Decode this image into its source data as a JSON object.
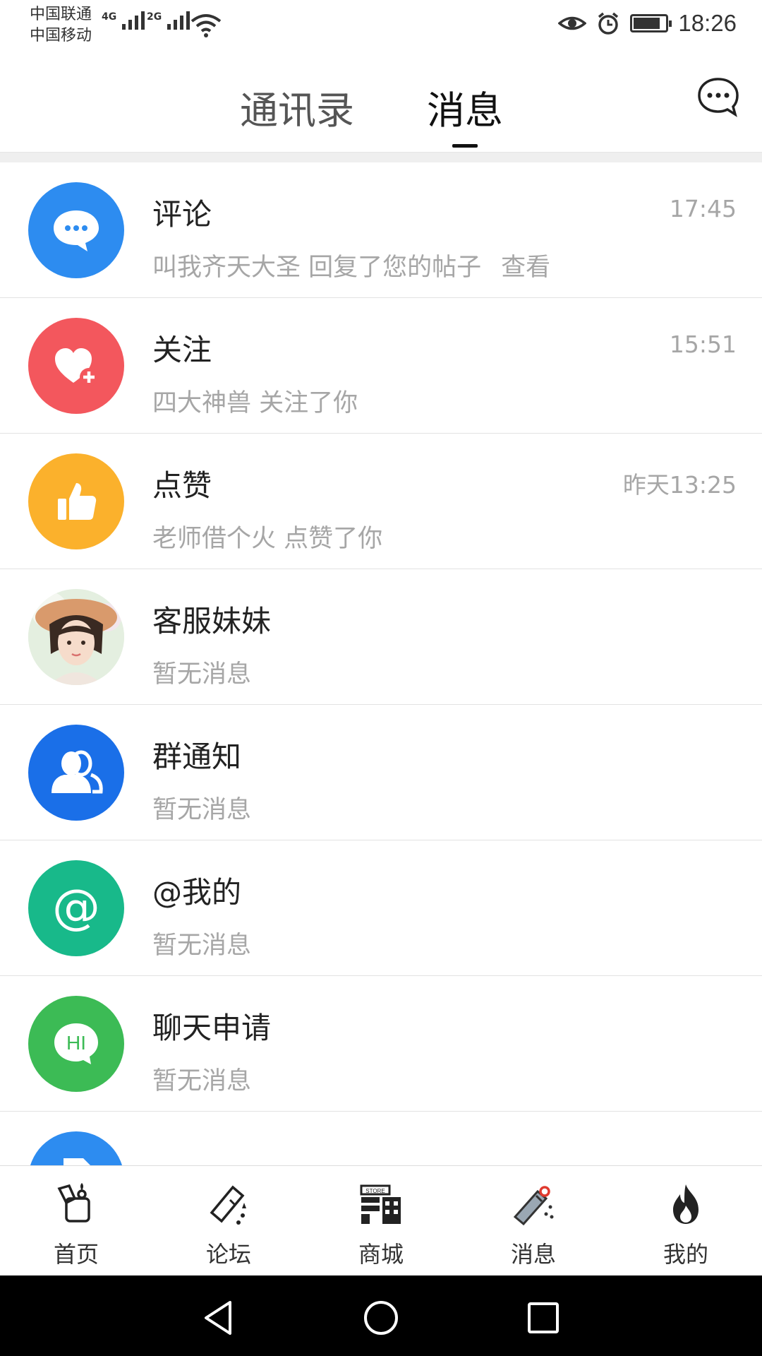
{
  "status_bar": {
    "carrier_1": "中国联通",
    "carrier_2": "中国移动",
    "net_1": "4G",
    "net_2": "2G",
    "time": "18:26",
    "battery_level": 0.85
  },
  "header": {
    "tabs": [
      {
        "label": "通讯录",
        "active": false
      },
      {
        "label": "消息",
        "active": true
      }
    ],
    "action_icon": "chat-bubble-icon"
  },
  "messages": [
    {
      "title": "评论",
      "time": "17:45",
      "subtitle": "叫我齐天大圣 回复了您的帖子",
      "link": "查看",
      "icon": "comment-bubble-icon",
      "color": "#2d8cf0"
    },
    {
      "title": "关注",
      "time": "15:51",
      "subtitle": "四大神兽 关注了你",
      "icon": "heart-plus-icon",
      "color": "#f3575d"
    },
    {
      "title": "点赞",
      "time": "昨天13:25",
      "subtitle": "老师借个火 点赞了你",
      "icon": "thumbs-up-icon",
      "color": "#fbb12c"
    },
    {
      "title": "客服妹妹",
      "time": "",
      "subtitle": "暂无消息",
      "icon": "avatar-photo"
    },
    {
      "title": "群通知",
      "time": "",
      "subtitle": "暂无消息",
      "icon": "group-users-icon",
      "color": "#1a6fe8"
    },
    {
      "title": "@我的",
      "time": "",
      "subtitle": "暂无消息",
      "icon": "at-sign-icon",
      "color": "#18b98a"
    },
    {
      "title": "聊天申请",
      "time": "",
      "subtitle": "暂无消息",
      "icon": "hi-bubble-icon",
      "color": "#3cbb55"
    }
  ],
  "bottom_nav": [
    {
      "label": "首页",
      "icon": "home-lighter-icon"
    },
    {
      "label": "论坛",
      "icon": "forum-lighter-icon"
    },
    {
      "label": "商城",
      "icon": "store-icon"
    },
    {
      "label": "消息",
      "icon": "message-lighter-icon",
      "active": true
    },
    {
      "label": "我的",
      "icon": "flame-icon"
    }
  ],
  "system_nav": [
    "back-icon",
    "home-circle-icon",
    "recents-square-icon"
  ]
}
